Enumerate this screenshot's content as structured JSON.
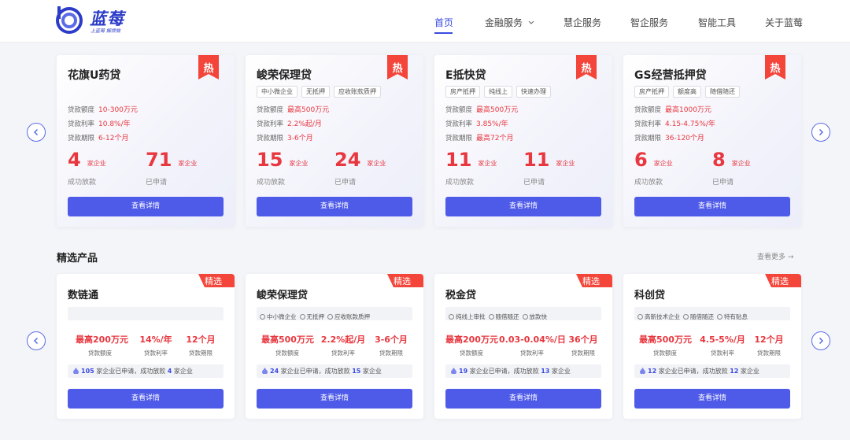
{
  "brand": {
    "name": "蓝莓",
    "slogan": "上蓝莓 解烦恼"
  },
  "nav": [
    {
      "label": "首页",
      "active": true
    },
    {
      "label": "金融服务",
      "has_dropdown": true
    },
    {
      "label": "慧企服务"
    },
    {
      "label": "智企服务"
    },
    {
      "label": "智能工具"
    },
    {
      "label": "关于蓝莓"
    }
  ],
  "hot_badge": "热",
  "pick_badge": "精选",
  "spec_labels": {
    "amount": "贷款额度",
    "rate": "贷款利率",
    "term": "贷款期限"
  },
  "stat_labels": {
    "unit": "家企业",
    "loaned": "成功放款",
    "applied": "已申请"
  },
  "detail_button": "查看详情",
  "hot_products": [
    {
      "title": "花旗U药贷",
      "tags": [],
      "amount": "10-300万元",
      "rate": "10.8%/年",
      "term": "6-12个月",
      "loaned": "4",
      "applied": "71"
    },
    {
      "title": "峻荣保理贷",
      "tags": [
        "中小微企业",
        "无抵押",
        "应收账款质押"
      ],
      "amount": "最高500万元",
      "rate": "2.2%起/月",
      "term": "3-6个月",
      "loaned": "15",
      "applied": "24"
    },
    {
      "title": "E抵快贷",
      "tags": [
        "房产抵押",
        "纯线上",
        "快速办理"
      ],
      "amount": "最高500万元",
      "rate": "3.85%/年",
      "term": "最高72个月",
      "loaned": "11",
      "applied": "11"
    },
    {
      "title": "GS经营抵押贷",
      "tags": [
        "房产抵押",
        "额度高",
        "随借随还"
      ],
      "amount": "最高1000万元",
      "rate": "4.15-4.75%/年",
      "term": "36-120个月",
      "loaned": "6",
      "applied": "8"
    }
  ],
  "section": {
    "title": "精选产品",
    "see_more": "查看更多 →"
  },
  "stat_text": {
    "a": "家企业已申请，成功放款",
    "b": "家企业"
  },
  "picks": [
    {
      "title": "数链通",
      "features": [],
      "amount": "最高200万元",
      "rate": "14%/年",
      "term": "12个月",
      "applied": "105",
      "loaned": "4"
    },
    {
      "title": "峻荣保理贷",
      "features": [
        "中小微企业",
        "无抵押",
        "应收账款质押"
      ],
      "amount": "最高500万元",
      "rate": "2.2%起/月",
      "term": "3-6个月",
      "applied": "24",
      "loaned": "15"
    },
    {
      "title": "税金贷",
      "features": [
        "纯线上审批",
        "随借随还",
        "放款快"
      ],
      "amount": "最高200万元",
      "rate": "0.03-0.04%/日",
      "term": "36个月",
      "applied": "19",
      "loaned": "13"
    },
    {
      "title": "科创贷",
      "features": [
        "高新技术企业",
        "随借随还",
        "特有贴息"
      ],
      "amount": "最高500万元",
      "rate": "4.5-5%/月",
      "term": "12个月",
      "applied": "12",
      "loaned": "12"
    }
  ],
  "colors": {
    "accent": "#4e5ae8",
    "highlight": "#e8373f",
    "badge": "#f3453a"
  }
}
